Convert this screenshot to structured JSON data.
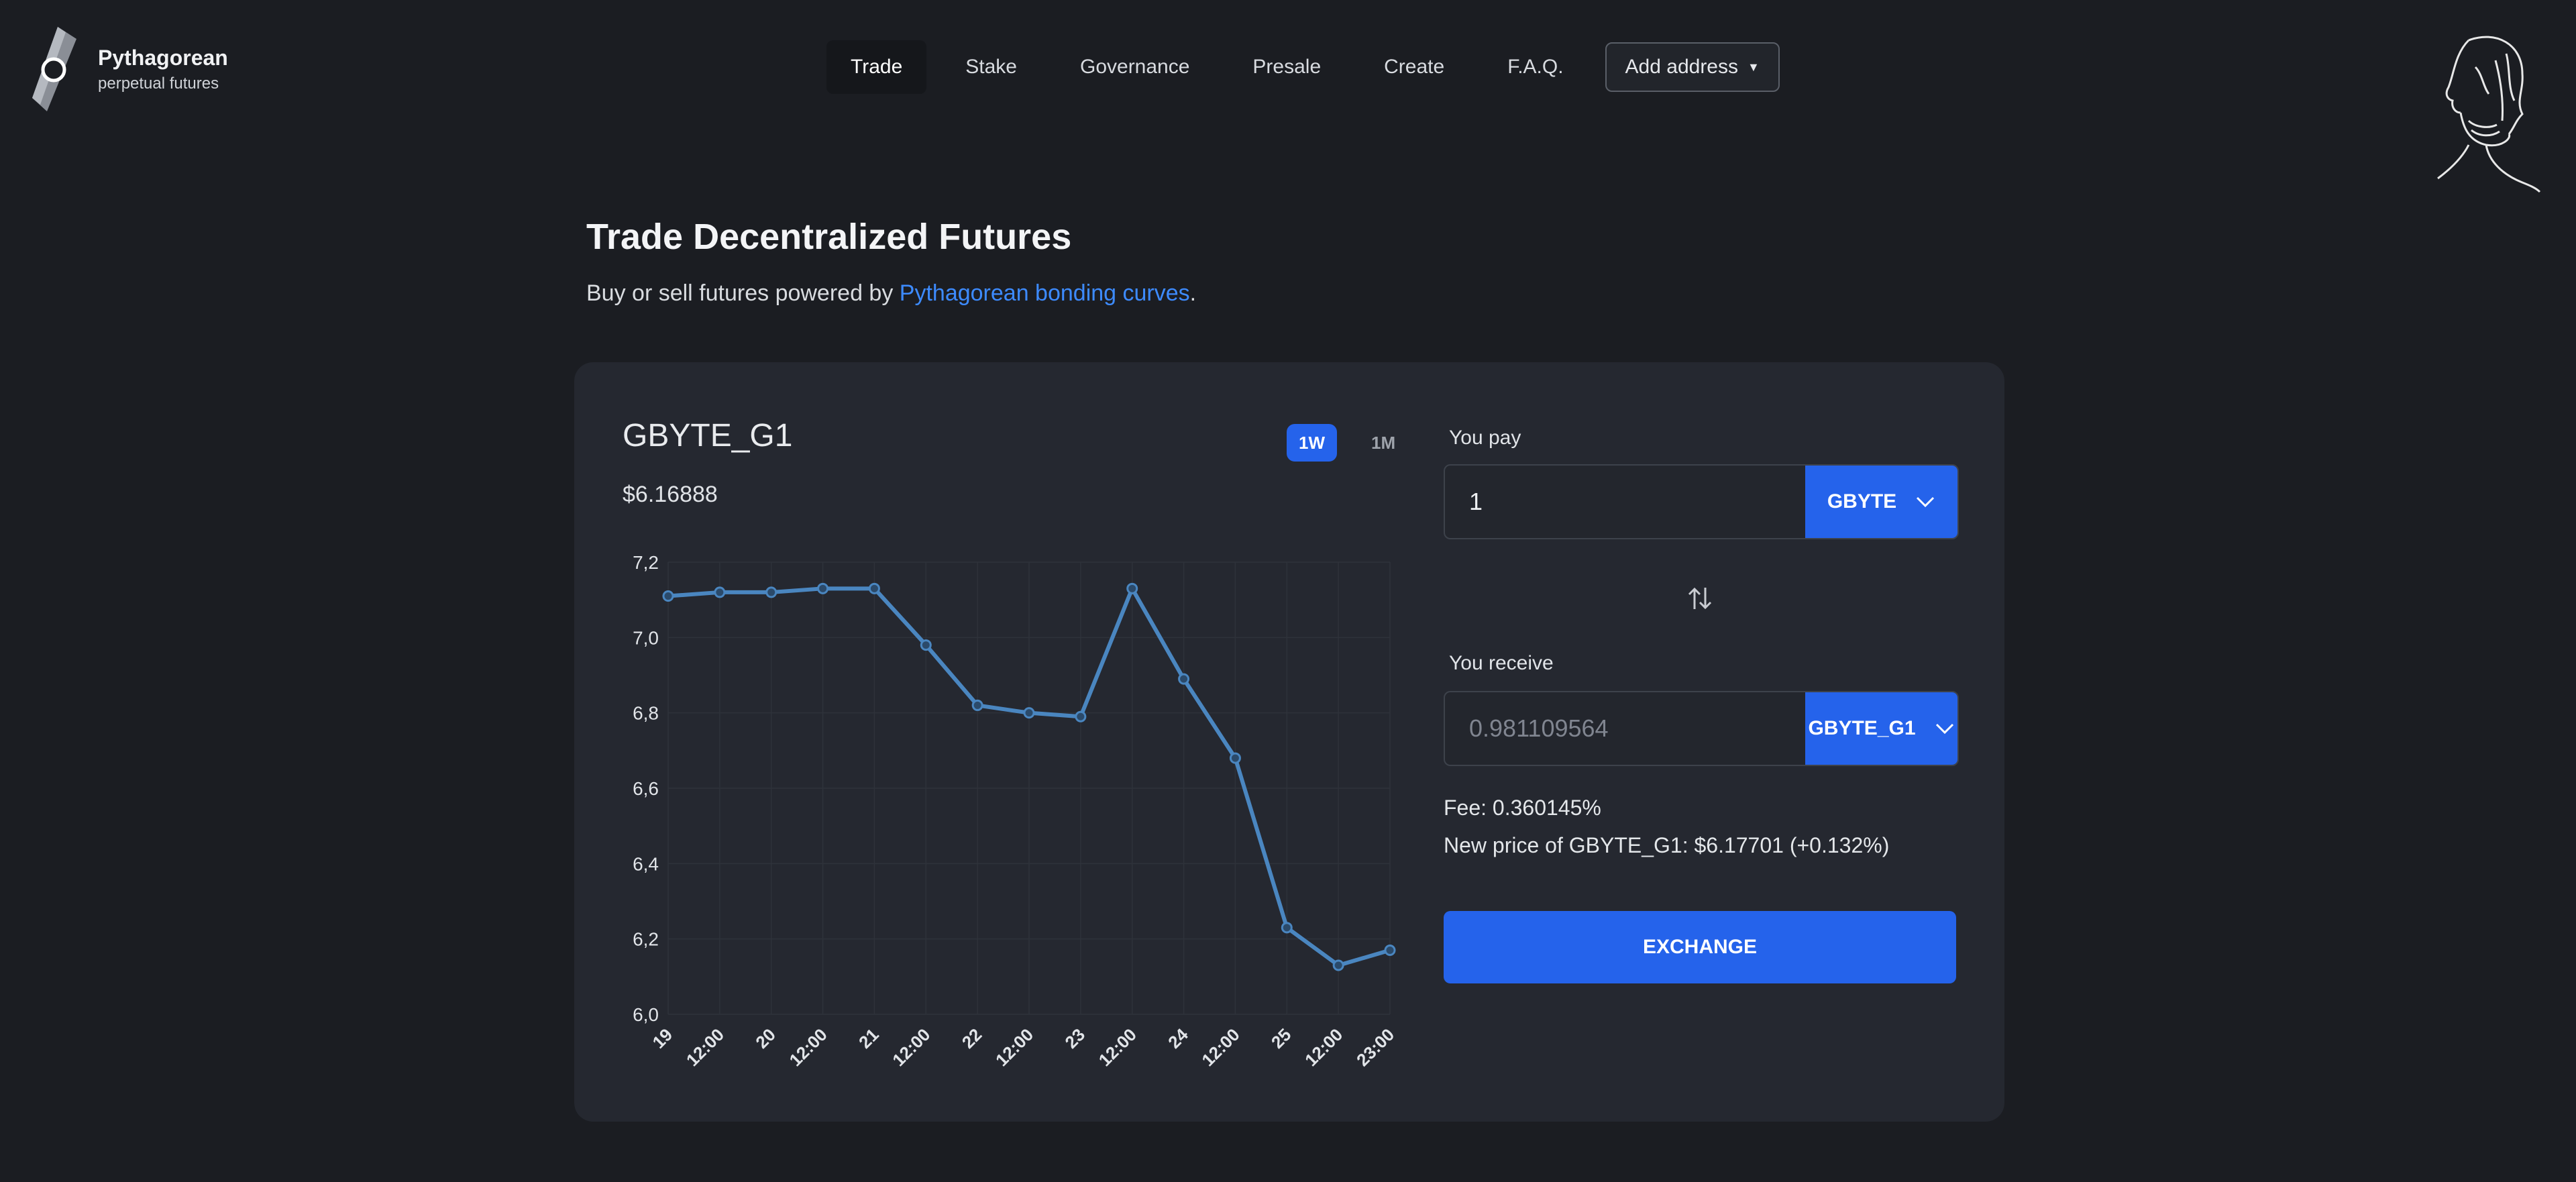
{
  "brand": {
    "title": "Pythagorean",
    "subtitle": "perpetual futures"
  },
  "nav": {
    "items": [
      "Trade",
      "Stake",
      "Governance",
      "Presale",
      "Create",
      "F.A.Q."
    ],
    "active": "Trade",
    "address_label": "Add address"
  },
  "hero": {
    "title": "Trade Decentralized Futures",
    "subtitle_prefix": "Buy or sell futures powered by ",
    "subtitle_link": "Pythagorean bonding curves",
    "subtitle_suffix": "."
  },
  "market": {
    "token": "GBYTE_G1",
    "price": "$6.16888",
    "ranges": [
      "1W",
      "1M"
    ],
    "active_range": "1W"
  },
  "trade": {
    "pay_label": "You pay",
    "pay_value": "1",
    "pay_token": "GBYTE",
    "receive_label": "You receive",
    "receive_placeholder": "0.981109564",
    "receive_token": "GBYTE_G1",
    "fee": "Fee: 0.360145%",
    "new_price": "New price of GBYTE_G1: $6.17701 (+0.132%)",
    "exchange_label": "EXCHANGE"
  },
  "colors": {
    "accent": "#2563eb",
    "line": "#4a86c0",
    "link": "#3d8bff"
  },
  "chart_data": {
    "type": "line",
    "x": [
      "19",
      "12:00",
      "20",
      "12:00",
      "21",
      "12:00",
      "22",
      "12:00",
      "23",
      "12:00",
      "24",
      "12:00",
      "25",
      "12:00",
      "23:00"
    ],
    "values": [
      7.11,
      7.12,
      7.12,
      7.13,
      7.13,
      6.98,
      6.82,
      6.8,
      6.79,
      7.13,
      6.89,
      6.68,
      6.23,
      6.13,
      6.17
    ],
    "y_ticks": [
      "6,0",
      "6,2",
      "6,4",
      "6,6",
      "6,8",
      "7,0",
      "7,2"
    ],
    "ylim": [
      6.0,
      7.2
    ],
    "grid": true
  }
}
